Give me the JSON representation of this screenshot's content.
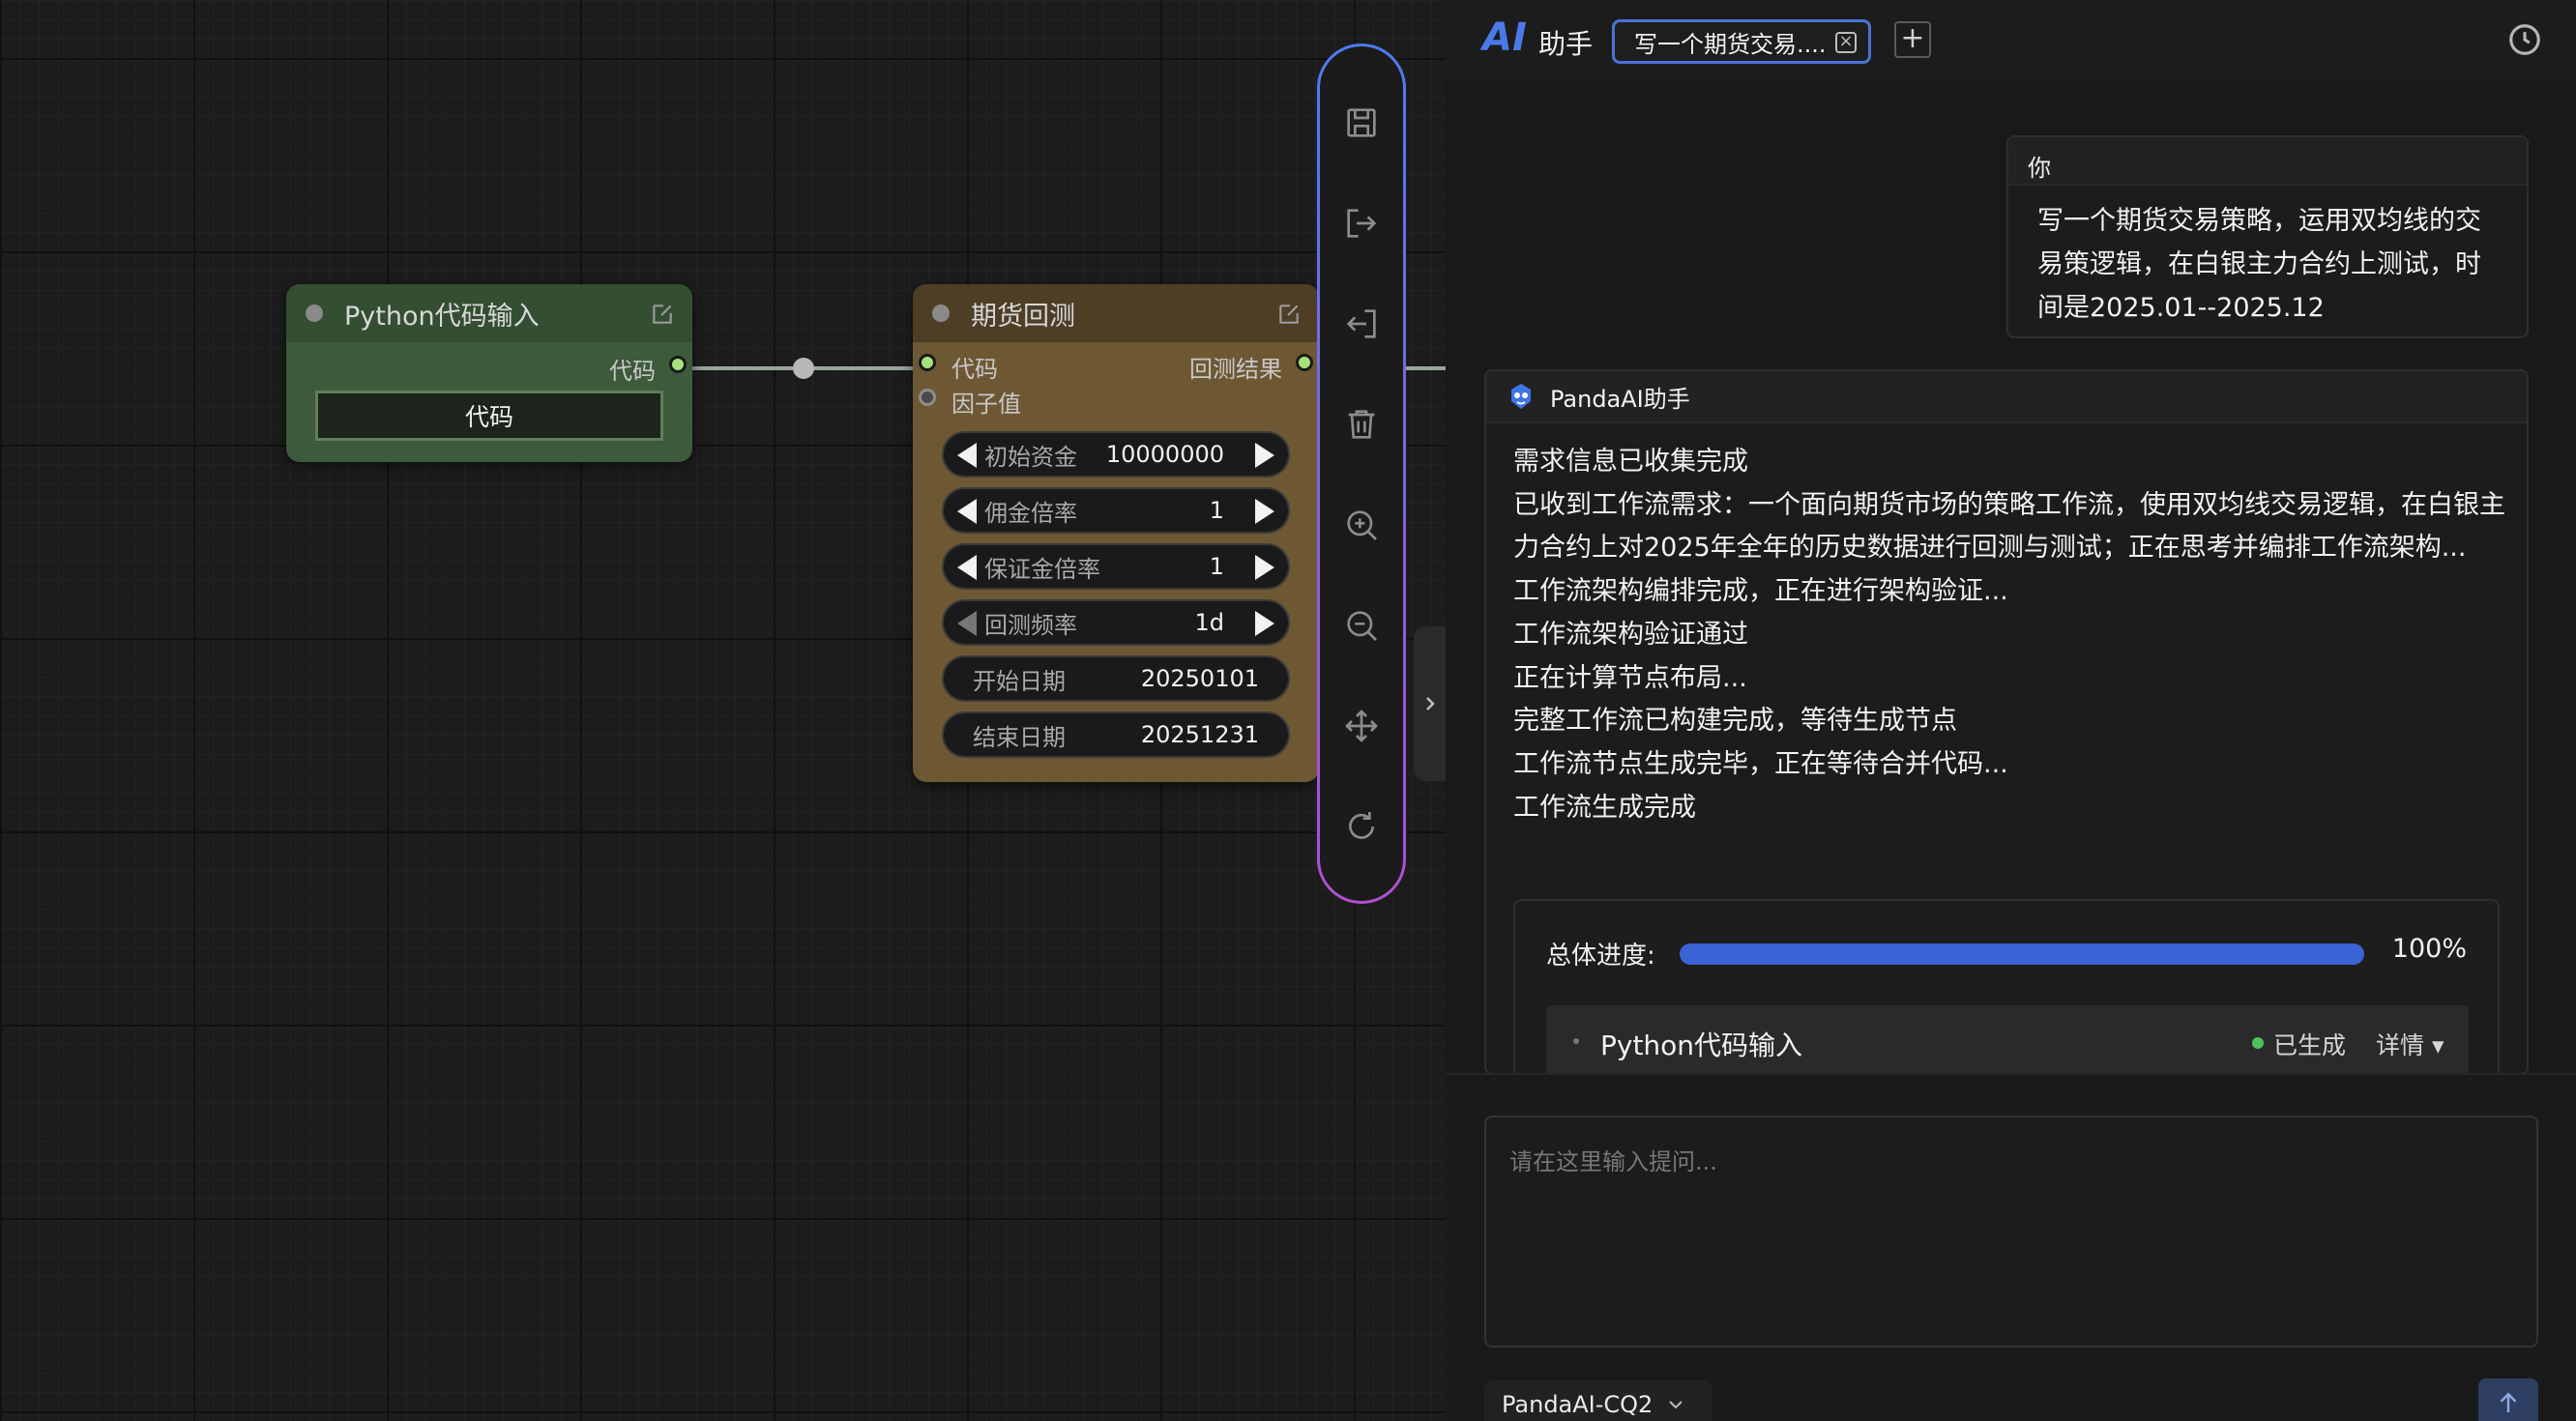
{
  "canvas": {
    "nodes": {
      "python": {
        "title": "Python代码输入",
        "output_port": "代码",
        "widget_text": "代码"
      },
      "futures": {
        "title": "期货回测",
        "input_port_code": "代码",
        "input_port_factor": "因子值",
        "output_port": "回测结果",
        "widgets": [
          {
            "label": "初始资金",
            "value": "10000000"
          },
          {
            "label": "佣金倍率",
            "value": "1"
          },
          {
            "label": "保证金倍率",
            "value": "1"
          },
          {
            "label": "回测频率",
            "value": "1d"
          },
          {
            "label": "开始日期",
            "value": "20250101"
          },
          {
            "label": "结束日期",
            "value": "20251231"
          }
        ]
      }
    },
    "toolbar_icons": [
      "save-icon",
      "export-icon",
      "import-icon",
      "trash-icon",
      "zoom-in-icon",
      "zoom-out-icon",
      "move-icon",
      "refresh-icon"
    ]
  },
  "panel": {
    "logo": "AI",
    "title": "助手",
    "tab_label": "写一个期货交易....",
    "add_tab": "+",
    "user_card": {
      "sender": "你",
      "message": "写一个期货交易策略，运用双均线的交易策逻辑，在白银主力合约上测试，时间是2025.01--2025.12"
    },
    "bot_card": {
      "sender": "PandaAI助手",
      "lines": [
        "需求信息已收集完成",
        "已收到工作流需求：一个面向期货市场的策略工作流，使用双均线交易逻辑，在白银主力合约上对2025年全年的历史数据进行回测与测试；正在思考并编排工作流架构...",
        "工作流架构编排完成，正在进行架构验证...",
        "工作流架构验证通过",
        "正在计算节点布局...",
        "完整工作流已构建完成，等待生成节点",
        "工作流节点生成完毕，正在等待合并代码...",
        "工作流生成完成"
      ],
      "progress": {
        "label": "总体进度:",
        "percent_text": "100%",
        "value": 1.0
      },
      "step": {
        "name": "Python代码输入",
        "status": "已生成",
        "detail": "详情 ▾"
      }
    },
    "input": {
      "placeholder": "请在这里输入提问...",
      "value": ""
    },
    "model": "PandaAI-CQ2",
    "colors": {
      "accent": "#4a72d8",
      "progress": "#3a63d6",
      "status_ok": "#4fc05a"
    }
  }
}
